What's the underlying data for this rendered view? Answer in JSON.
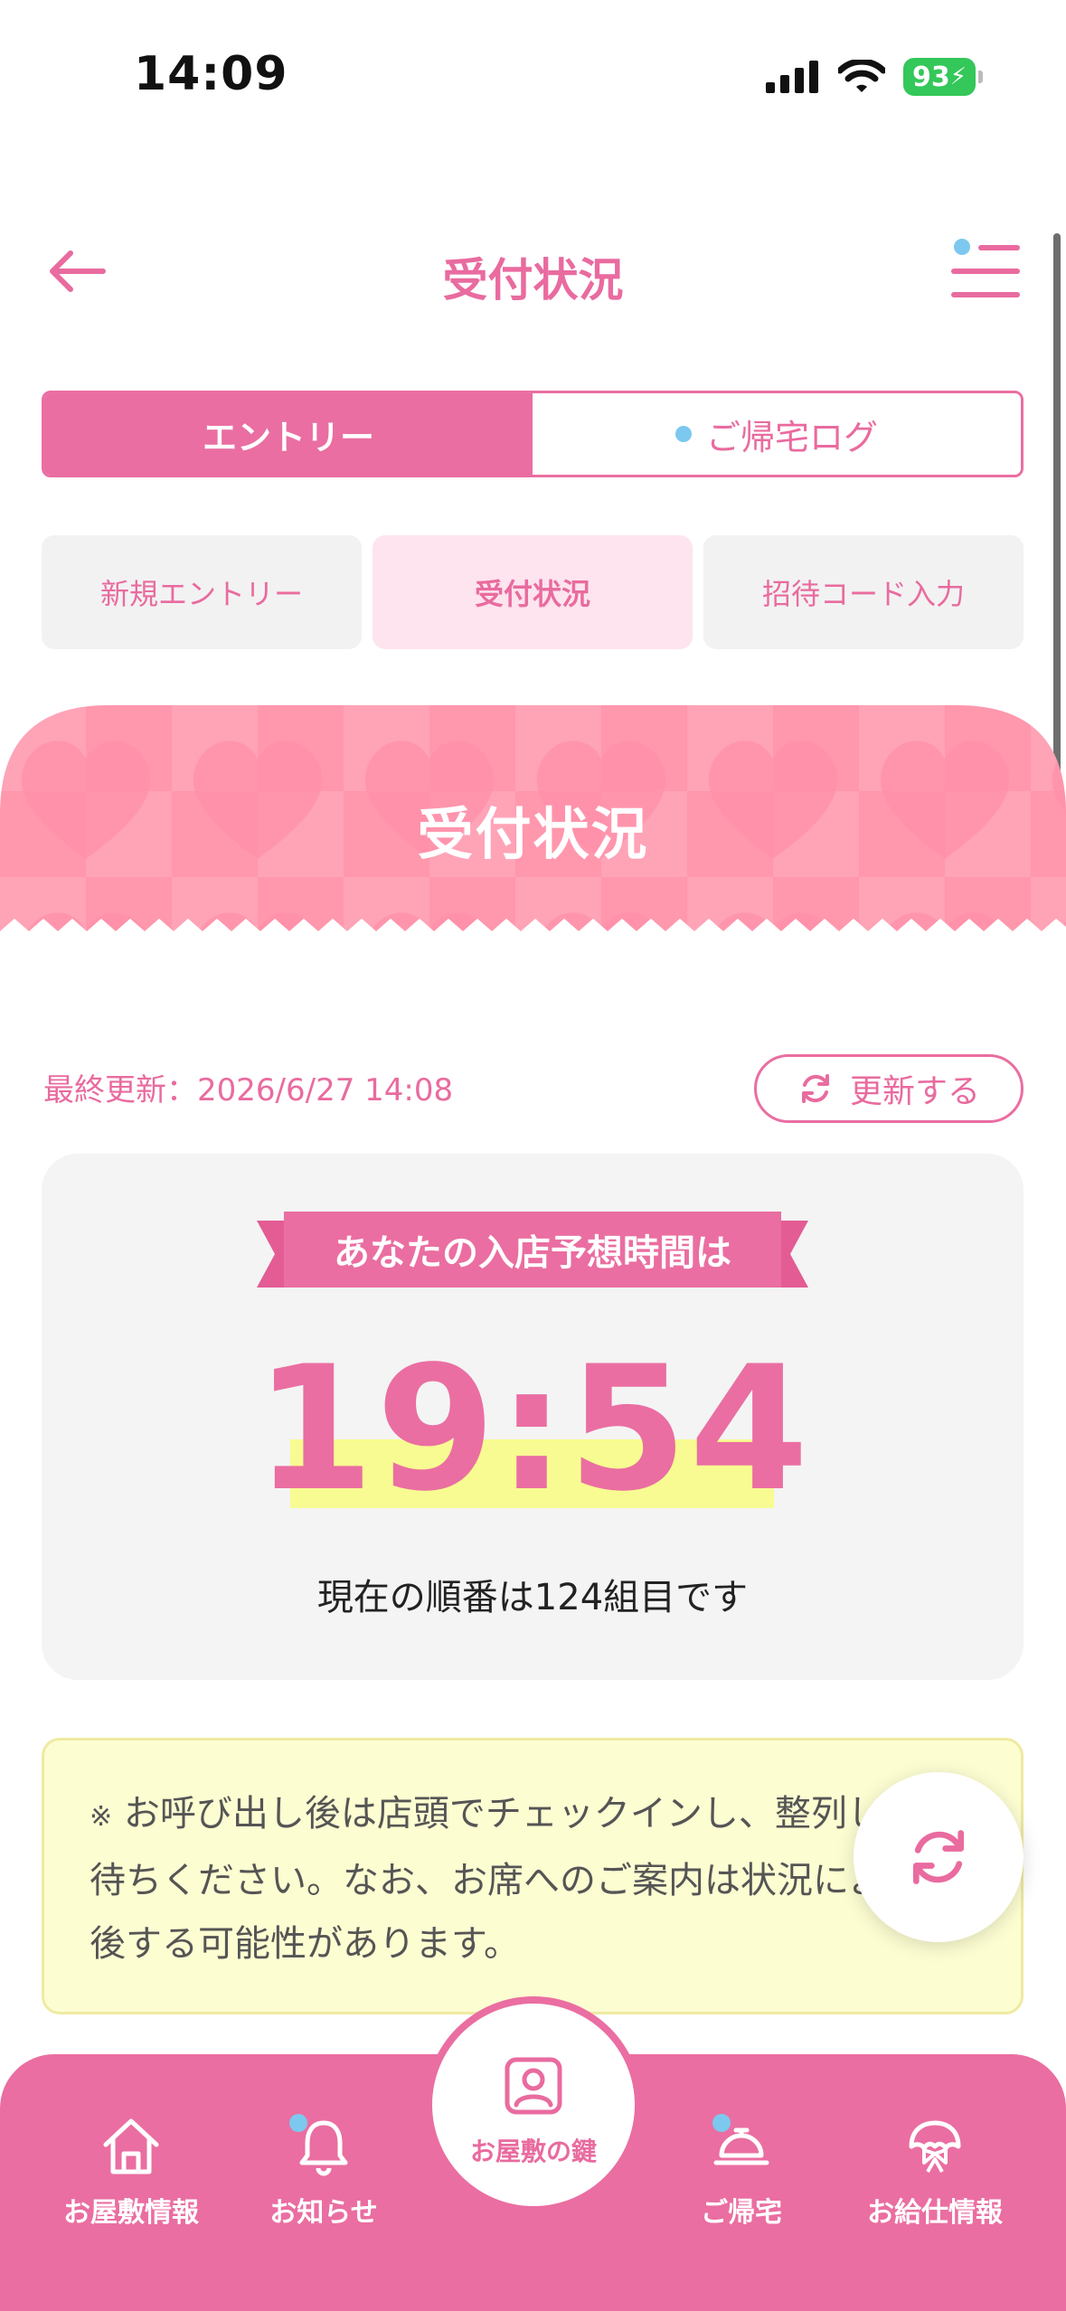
{
  "status_bar": {
    "time": "14:09",
    "battery": "93"
  },
  "header": {
    "title": "受付状況"
  },
  "segment": {
    "entry": "エントリー",
    "homecoming_log": "ご帰宅ログ"
  },
  "subtabs": [
    "新規エントリー",
    "受付状況",
    "招待コード入力"
  ],
  "banner": {
    "title": "受付状況"
  },
  "updated": {
    "text": "最終更新：2026/6/27 14:08",
    "refresh_label": "更新する"
  },
  "card": {
    "ribbon": "あなたの入店予想時間は",
    "time": "19:54",
    "order": "現在の順番は124組目です"
  },
  "notice": {
    "mark": "※",
    "text": "お呼び出し後は店頭でチェックインし、整列してお待ちください。なお、お席へのご案内は状況により前後する可能性があります。"
  },
  "tabbar": {
    "items": [
      "お屋敷情報",
      "お知らせ",
      "お屋敷の鍵",
      "ご帰宅",
      "お給仕情報"
    ]
  },
  "colors": {
    "accent": "#ea6ea1",
    "dot": "#7cc8ef",
    "highlight": "#f8fb92",
    "notice_bg": "#fdfdd2"
  }
}
